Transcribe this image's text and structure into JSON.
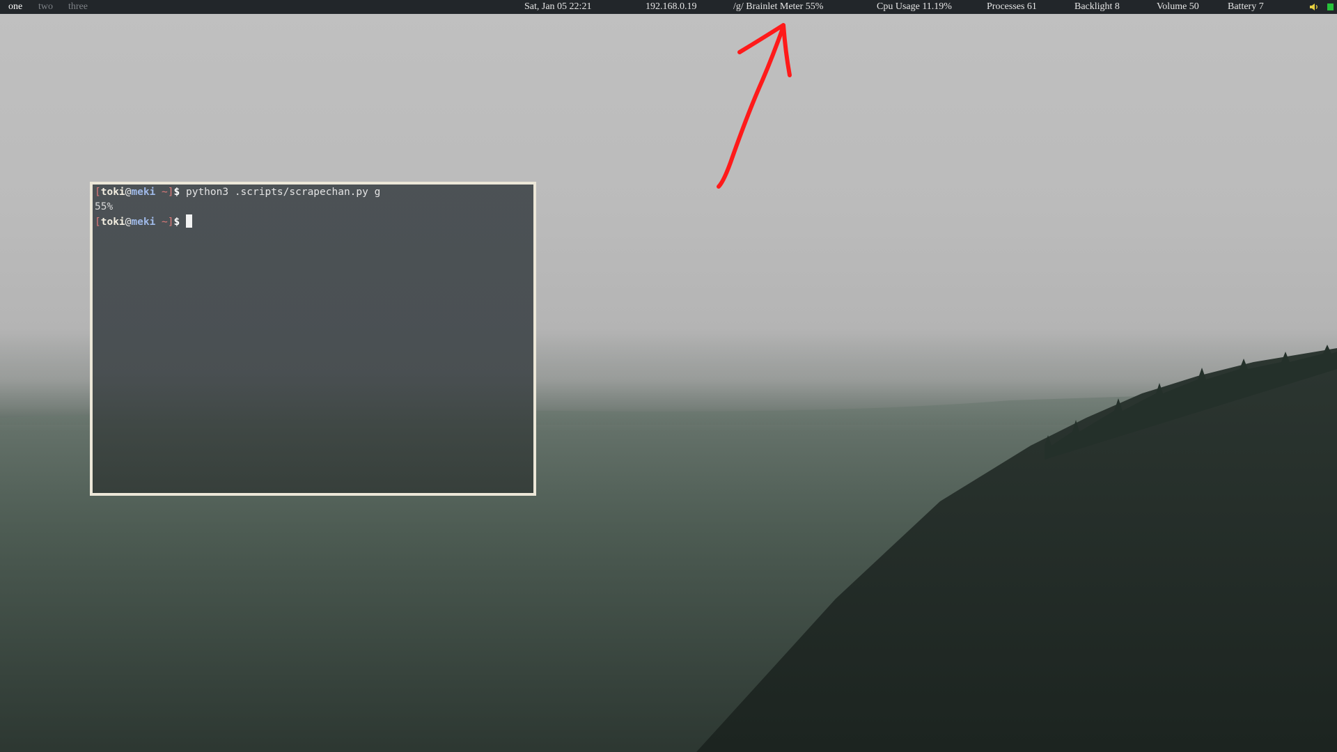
{
  "workspaces": [
    {
      "label": "one",
      "active": true
    },
    {
      "label": "two",
      "active": false
    },
    {
      "label": "three",
      "active": false
    }
  ],
  "status": {
    "datetime": "Sat, Jan 05 22:21",
    "ip": "192.168.0.19",
    "brainlet": "/g/ Brainlet Meter 55%",
    "cpu": "Cpu Usage 11.19%",
    "processes": "Processes 61",
    "backlight": "Backlight 8",
    "volume": "Volume 50",
    "battery": "Battery 7"
  },
  "tray": {
    "volume_icon": "speaker-icon",
    "network_icon": "network-status-icon",
    "network_color": "#27c23a"
  },
  "terminal": {
    "prompt_user": "toki",
    "prompt_at": "@",
    "prompt_host": "meki",
    "prompt_dir": " ~",
    "prompt_open": "[",
    "prompt_close": "]",
    "prompt_symbol": "$",
    "command": " python3 .scripts/scrapechan.py g",
    "output": "55%"
  },
  "colors": {
    "bar_bg": "#22262a",
    "terminal_border": "#ece7d8",
    "arrow": "#ff0000"
  }
}
